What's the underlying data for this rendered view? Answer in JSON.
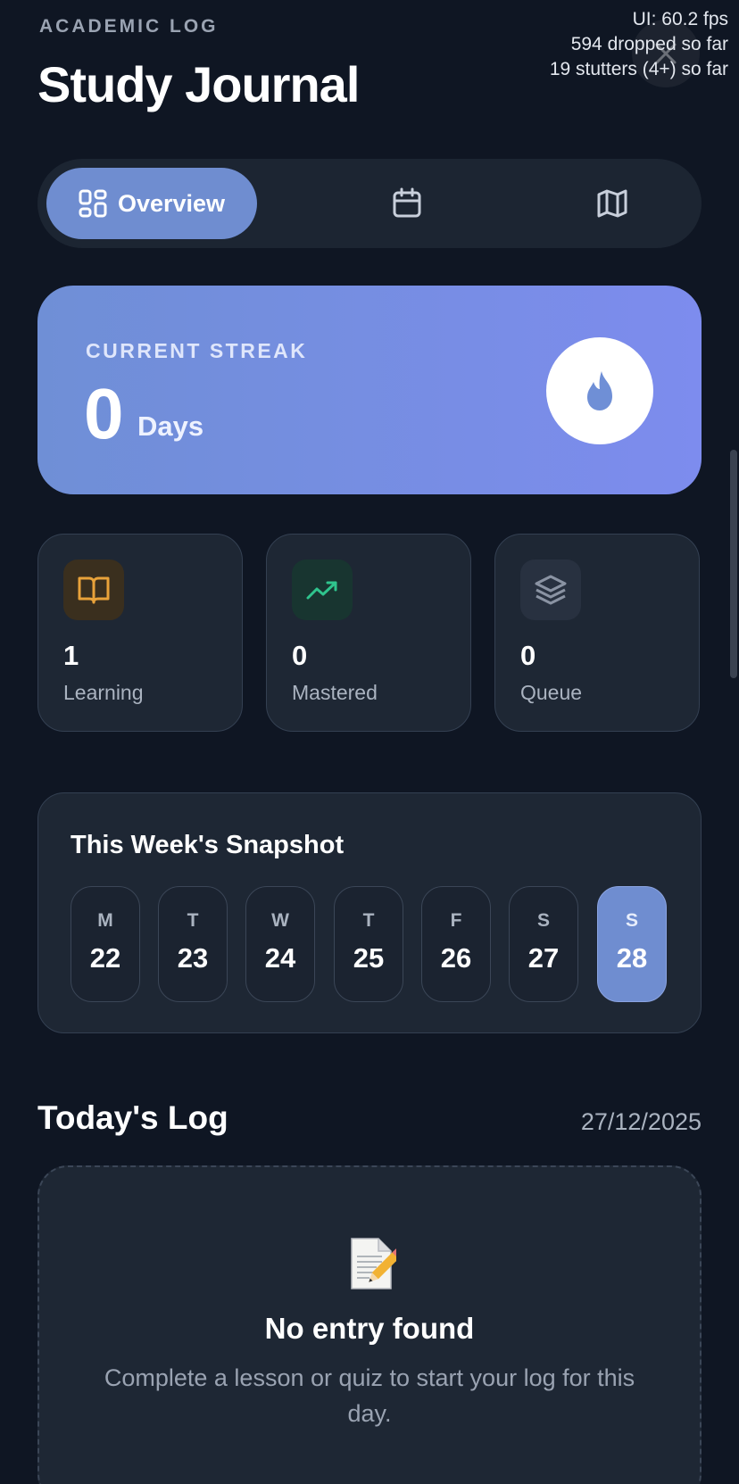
{
  "header": {
    "eyebrow": "ACADEMIC LOG",
    "title": "Study Journal"
  },
  "perf_overlay": {
    "line1": "UI: 60.2 fps",
    "line2": "594 dropped so far",
    "line3": "19 stutters (4+) so far"
  },
  "tabs": [
    {
      "label": "Overview",
      "icon": "grid-icon",
      "active": true
    },
    {
      "label": "",
      "icon": "calendar-icon",
      "active": false
    },
    {
      "label": "",
      "icon": "map-icon",
      "active": false
    }
  ],
  "streak": {
    "label": "CURRENT STREAK",
    "value": "0",
    "unit": "Days",
    "icon": "flame-icon"
  },
  "stats": [
    {
      "value": "1",
      "label": "Learning",
      "icon": "book-icon",
      "accent": "#e8a23a"
    },
    {
      "value": "0",
      "label": "Mastered",
      "icon": "trending-up-icon",
      "accent": "#2fc48d"
    },
    {
      "value": "0",
      "label": "Queue",
      "icon": "layers-icon",
      "accent": "#8a93a3"
    }
  ],
  "week": {
    "title": "This Week's Snapshot",
    "days": [
      {
        "letter": "M",
        "num": "22"
      },
      {
        "letter": "T",
        "num": "23"
      },
      {
        "letter": "W",
        "num": "24"
      },
      {
        "letter": "T",
        "num": "25"
      },
      {
        "letter": "F",
        "num": "26"
      },
      {
        "letter": "S",
        "num": "27"
      },
      {
        "letter": "S",
        "num": "28",
        "today": true
      }
    ]
  },
  "log": {
    "title": "Today's Log",
    "date": "27/12/2025",
    "empty_title": "No entry found",
    "empty_text": "Complete a lesson or quiz to start your log for this day.",
    "icon": "memo-icon"
  },
  "colors": {
    "background": "#0f1623",
    "card": "#1e2734",
    "accent": "#6f8dd0"
  }
}
